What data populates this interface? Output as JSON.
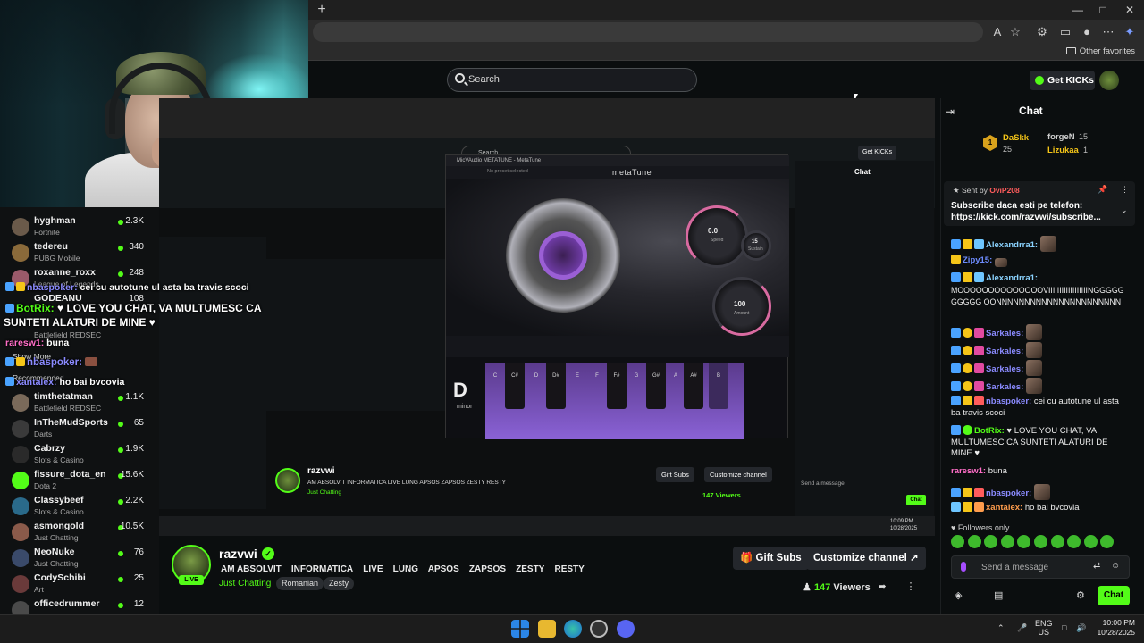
{
  "browser": {
    "new_tab": "+",
    "other_favorites": "Other favorites"
  },
  "topnav": {
    "search_placeholder": "Search",
    "get_kicks": "Get KICKs"
  },
  "sidebar": {
    "channels": [
      {
        "name": "hyghman",
        "category": "Fortnite",
        "viewers": "2.3K",
        "avatar_color": "#6a5a4a"
      },
      {
        "name": "tedereu",
        "category": "PUBG Mobile",
        "viewers": "340",
        "avatar_color": "#8a6a3a"
      },
      {
        "name": "roxanne_roxx",
        "category": "League of Legends",
        "viewers": "248",
        "avatar_color": "#9a5a6a"
      },
      {
        "name": "GODEANU",
        "category": "",
        "viewers": "108",
        "avatar_color": "#5a6a7a"
      },
      {
        "name": "",
        "category": "Battlefield REDSEC",
        "viewers": "",
        "avatar_color": "#4a5a3a"
      }
    ],
    "show_more": "Show More",
    "recommended_label": "Recommended",
    "recommended": [
      {
        "name": "timthetatman",
        "category": "Battlefield REDSEC",
        "viewers": "1.1K",
        "avatar_color": "#7a6a5a"
      },
      {
        "name": "InTheMudSports",
        "category": "Darts",
        "viewers": "65",
        "avatar_color": "#3a3a3a"
      },
      {
        "name": "Cabrzy",
        "category": "Slots & Casino",
        "viewers": "1.9K",
        "avatar_color": "#2a2a2a"
      },
      {
        "name": "fissure_dota_en",
        "category": "Dota 2",
        "viewers": "15.6K",
        "avatar_color": "#53fc18"
      },
      {
        "name": "Classybeef",
        "category": "Slots & Casino",
        "viewers": "2.2K",
        "avatar_color": "#2a6a8a"
      },
      {
        "name": "asmongold",
        "category": "Just Chatting",
        "viewers": "10.5K",
        "avatar_color": "#8a5a4a"
      },
      {
        "name": "NeoNuke",
        "category": "Just Chatting",
        "viewers": "76",
        "avatar_color": "#3a4a6a"
      },
      {
        "name": "CodySchibi",
        "category": "Art",
        "viewers": "25",
        "avatar_color": "#6a3a3a"
      },
      {
        "name": "officedrummer",
        "category": "",
        "viewers": "12",
        "avatar_color": "#4a4a4a"
      }
    ]
  },
  "overlay_chat": [
    {
      "user": "nbaspoker:",
      "text": "cei cu autotune ul asta ba travis scoci"
    },
    {
      "user": "BotRix:",
      "text": "♥ LOVE YOU CHAT, VA MULTUMESC CA"
    },
    {
      "user": "",
      "text": "SUNTETI ALATURI DE MINE ♥"
    },
    {
      "user": "raresw1:",
      "text": "buna"
    },
    {
      "user": "nbaspoker:",
      "text": ""
    },
    {
      "user": "xantalex:",
      "text": "ho bai bvcovia"
    }
  ],
  "nested": {
    "search": "Search",
    "get_kicks": "Get KICKs",
    "chat_title": "Chat",
    "metatune_title": "MicVAudio METATUNE - MetaTune",
    "metatune_logo": "metaTune",
    "no_preset": "No preset selected",
    "speed_value": "0.0",
    "speed_label": "Speed",
    "sustain_value": "15",
    "sustain_label": "Sustain",
    "amount_value": "100",
    "amount_label": "Amount",
    "key": "D",
    "mode": "minor",
    "keys": [
      "C",
      "C#",
      "D",
      "D#",
      "E",
      "F",
      "F#",
      "G",
      "G#",
      "A",
      "A#",
      "B"
    ],
    "channel": "razvwi",
    "title": "AM ABSOLVIT  INFORMATICA  LIVE  LUNG  APSOS  ZAPSOS  ZESTY  RESTY",
    "category": "Just Chatting",
    "gift_subs": "Gift Subs",
    "customize": "Customize channel",
    "viewers": "147 Viewers",
    "send_message": "Send a message",
    "chat_btn": "Chat",
    "clock_time": "10:09 PM",
    "clock_date": "10/28/2025"
  },
  "channel": {
    "avatar_label": "LIVE",
    "name": "razvwi",
    "title_words": [
      "AM ABSOLVIT",
      "INFORMATICA",
      "LIVE",
      "LUNG",
      "APSOS",
      "ZAPSOS",
      "ZESTY",
      "RESTY"
    ],
    "category": "Just Chatting",
    "tags": [
      "Romanian",
      "Zesty"
    ],
    "gift_subs": "Gift Subs",
    "customize": "Customize channel",
    "viewer_count": "147",
    "viewer_label": "Viewers"
  },
  "chat": {
    "title": "Chat",
    "top_gifters": [
      {
        "rank": "1",
        "name": "DaSkk",
        "count": "25",
        "color": "#f5c518"
      },
      {
        "name": "forgeN",
        "count": "15",
        "color": "#cfcfcf"
      },
      {
        "name": "Lizukaa",
        "count": "1",
        "color": "#f5c518"
      }
    ],
    "pinned": {
      "sent_by": "Sent by",
      "user": "OviP208",
      "text": "Subscribe daca esti pe telefon:",
      "link": "https://kick.com/razvwi/subscribe..."
    },
    "messages": [
      {
        "user": "Alexandrra1:",
        "text": "",
        "color": "#8bd3ff"
      },
      {
        "user": "Zipy15:",
        "text": "",
        "color": "#6e8cff"
      },
      {
        "user": "Alexandrra1:",
        "text": "MOOOOOOOOOOOOOOVIIIIIIIIIIIIIIIIIINGGGGGGGGGG OONNNNNNNNNNNNNNNNNNNNNN",
        "color": "#8bd3ff"
      },
      {
        "user": "Sarkales:",
        "text": "",
        "color": "#8b8bff"
      },
      {
        "user": "Sarkales:",
        "text": "",
        "color": "#8b8bff"
      },
      {
        "user": "Sarkales:",
        "text": "",
        "color": "#8b8bff"
      },
      {
        "user": "Sarkales:",
        "text": "",
        "color": "#8b8bff"
      },
      {
        "user": "nbaspoker:",
        "text": "cei cu autotune ul asta ba travis scoci",
        "color": "#8b8bff"
      },
      {
        "user": "BotRix:",
        "text": "♥ LOVE YOU CHAT, VA MULTUMESC CA SUNTETI ALATURI DE MINE ♥",
        "color": "#53fc18"
      },
      {
        "user": "raresw1:",
        "text": "buna",
        "color": "#ff6ec7"
      },
      {
        "user": "nbaspoker:",
        "text": "",
        "color": "#8b8bff"
      },
      {
        "user": "xantalex:",
        "text": "ho bai bvcovia",
        "color": "#ff9d4d"
      }
    ],
    "followers_only": "Followers only",
    "send_placeholder": "Send a message",
    "send_button": "Chat"
  },
  "taskbar": {
    "lang_top": "ENG",
    "lang_bottom": "US",
    "time": "10:00 PM",
    "date": "10/28/2025"
  },
  "colors": {
    "accent": "#53fc18",
    "background": "#0b0e0f"
  }
}
